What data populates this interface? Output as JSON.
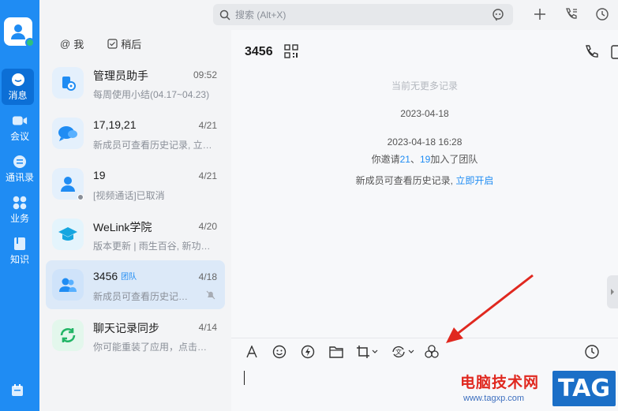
{
  "colors": {
    "brand": "#1f8cf3",
    "sidebar": "#1f8cf3",
    "selected_row": "#dce9f8",
    "annotation_arrow": "#e0281f",
    "online": "#2ec27e"
  },
  "nav": {
    "items": [
      {
        "label": "消息",
        "icon": "message-icon"
      },
      {
        "label": "会议",
        "icon": "video-icon"
      },
      {
        "label": "通讯录",
        "icon": "contacts-icon"
      },
      {
        "label": "业务",
        "icon": "apps-icon"
      },
      {
        "label": "知识",
        "icon": "book-icon"
      }
    ]
  },
  "search": {
    "placeholder": "搜索 (Alt+X)"
  },
  "conv_tabs": {
    "me": "我",
    "drafts": "稍后"
  },
  "conversations": [
    {
      "name": "管理员助手",
      "time": "09:52",
      "preview": "每周使用小结(04.17~04.23)"
    },
    {
      "name": "17,19,21",
      "time": "4/21",
      "preview": "新成员可查看历史记录, 立即开启"
    },
    {
      "name": "19",
      "time": "4/21",
      "preview": "[视频通话]已取消"
    },
    {
      "name": "WeLink学院",
      "time": "4/20",
      "preview": "版本更新 | 雨生百谷, 新功能上线"
    },
    {
      "name": "3456",
      "tag": "团队",
      "time": "4/18",
      "preview": "新成员可查看历史记录, 立即开启"
    },
    {
      "name": "聊天记录同步",
      "time": "4/14",
      "preview": "你可能重装了应用，点击同步聊天记录"
    }
  ],
  "chat": {
    "title": "3456",
    "no_more": "当前无更多记录",
    "date1": "2023-04-18",
    "date2": "2023-04-18 16:28",
    "invite_prefix": "你邀请",
    "invite_user1": "21",
    "invite_sep": "、",
    "invite_user2": "19",
    "invite_suffix": "加入了团队",
    "history_text": "新成员可查看历史记录, ",
    "history_link": "立即开启"
  },
  "watermark": {
    "site_name": "电脑技术网",
    "url": "www.tagxp.com",
    "logo": "TAG"
  }
}
